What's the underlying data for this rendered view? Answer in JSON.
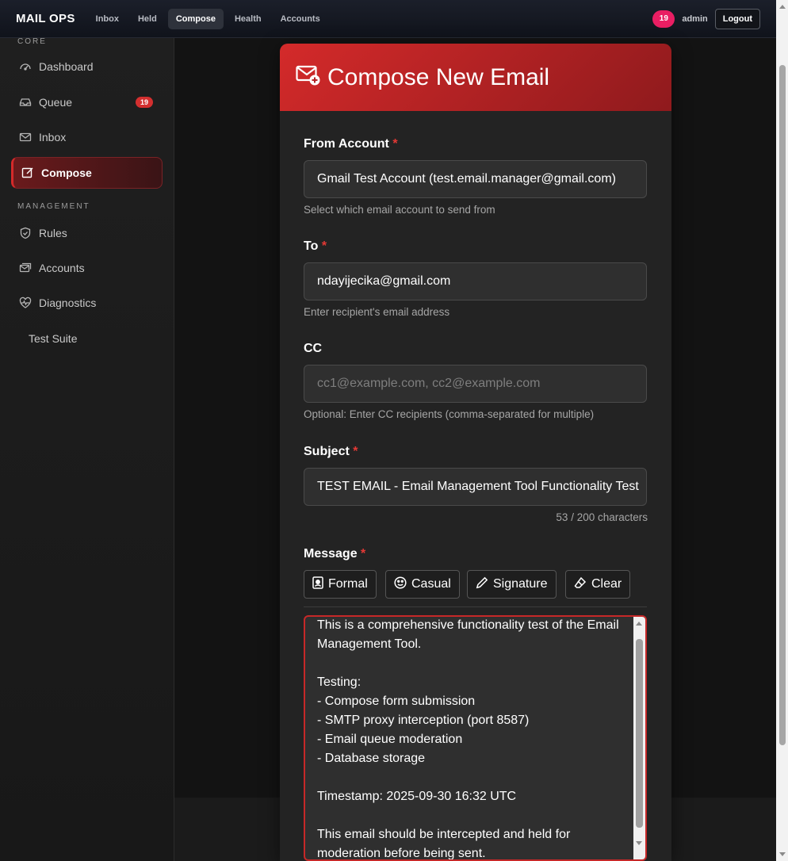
{
  "topnav": {
    "brand": "MAIL OPS",
    "links": [
      "Inbox",
      "Held",
      "Compose",
      "Health",
      "Accounts"
    ],
    "active": "Compose",
    "badge": "19",
    "user": "admin",
    "logout": "Logout"
  },
  "sidebar": {
    "section_core": "CORE",
    "section_management": "MANAGEMENT",
    "items": [
      {
        "label": "Dashboard",
        "icon": "gauge-icon"
      },
      {
        "label": "Queue",
        "icon": "inbox-tray-icon",
        "badge": "19"
      },
      {
        "label": "Inbox",
        "icon": "envelope-icon"
      },
      {
        "label": "Compose",
        "icon": "pencil-square-icon"
      },
      {
        "label": "Rules",
        "icon": "shield-check-icon"
      },
      {
        "label": "Accounts",
        "icon": "envelopes-icon"
      },
      {
        "label": "Diagnostics",
        "icon": "heart-pulse-icon"
      },
      {
        "label": "Test Suite",
        "icon": ""
      }
    ]
  },
  "compose": {
    "title": "Compose New Email",
    "from_label": "From Account",
    "from_value": "Gmail Test Account (test.email.manager@gmail.com)",
    "from_help": "Select which email account to send from",
    "to_label": "To",
    "to_value": "ndayijecika@gmail.com",
    "to_help": "Enter recipient's email address",
    "cc_label": "CC",
    "cc_placeholder": "cc1@example.com, cc2@example.com",
    "cc_help": "Optional: Enter CC recipients (comma-separated for multiple)",
    "subject_label": "Subject",
    "subject_value": "TEST EMAIL - Email Management Tool Functionality Test",
    "subject_counter": "53 / 200 characters",
    "message_label": "Message",
    "required_mark": "*",
    "templates": [
      "Formal",
      "Casual",
      "Signature",
      "Clear"
    ],
    "message_text": "This is a comprehensive functionality test of the Email Management Tool.\n\nTesting:\n- Compose form submission\n- SMTP proxy interception (port 8587)\n- Email queue moderation\n- Database storage\n\nTimestamp: 2025-09-30 16:32 UTC\n\nThis email should be intercepted and held for moderation before being sent."
  },
  "colors": {
    "accent": "#d42a2a",
    "badge": "#e91e63"
  }
}
